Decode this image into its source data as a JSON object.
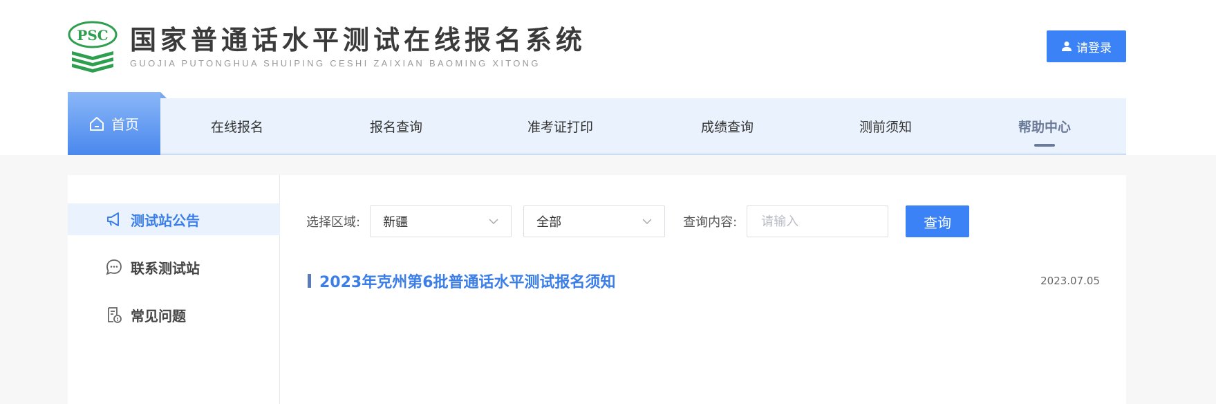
{
  "header": {
    "logo_badge": "PSC",
    "title": "国家普通话水平测试在线报名系统",
    "subtitle": "GUOJIA PUTONGHUA SHUIPING CESHI ZAIXIAN BAOMING XITONG",
    "login_label": "请登录"
  },
  "nav": {
    "home": "首页",
    "items": [
      "在线报名",
      "报名查询",
      "准考证打印",
      "成绩查询",
      "测前须知",
      "帮助中心"
    ],
    "active": "帮助中心"
  },
  "sidebar": {
    "items": [
      "测试站公告",
      "联系测试站",
      "常见问题"
    ]
  },
  "filter": {
    "region_label": "选择区域:",
    "region_value": "新疆",
    "category_value": "全部",
    "content_label": "查询内容:",
    "content_placeholder": "请输入",
    "query_label": "查询"
  },
  "notices": [
    {
      "title": "2023年克州第6批普通话水平测试报名须知",
      "date": "2023.07.05"
    }
  ],
  "colors": {
    "accent": "#3b82f6",
    "nav_bg": "#eaf3fd",
    "active_nav": "#6b7a99",
    "logo_green": "#2e9e4f"
  }
}
